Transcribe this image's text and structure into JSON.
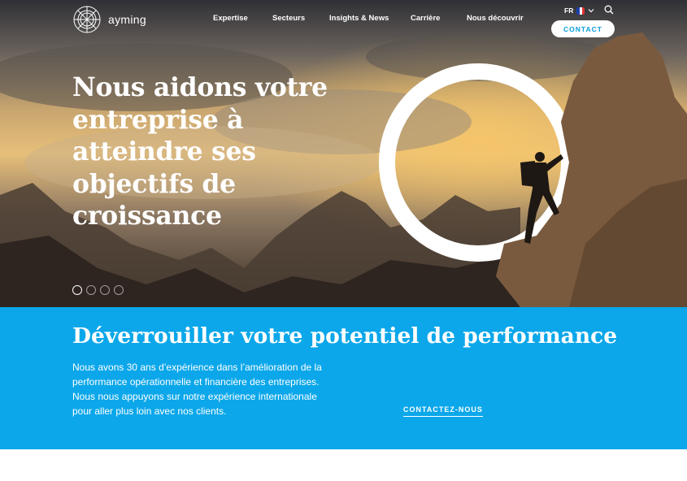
{
  "brand": {
    "name": "ayming"
  },
  "nav": {
    "items": [
      {
        "label": "Expertise"
      },
      {
        "label": "Secteurs"
      },
      {
        "label": "Insights & News"
      },
      {
        "label": "Carrière"
      },
      {
        "label": "Nous découvrir"
      }
    ],
    "language": "FR",
    "contact_label": "CONTACT"
  },
  "hero": {
    "headline": "Nous aidons votre entreprise à atteindre ses objectifs de croissance",
    "slides_total": 4,
    "active_slide": 1
  },
  "promo": {
    "title": "Déverrouiller votre potentiel de performance",
    "body": "Nous avons 30 ans d’expérience dans l’amélioration de la performance opérationnelle et financière des entreprises. Nous nous appuyons sur notre expérience internationale pour aller plus loin avec nos clients.",
    "cta_label": "CONTACTEZ-NOUS"
  },
  "colors": {
    "accent_blue": "#0ba7ea",
    "contact_text": "#0b9fdc"
  },
  "icons": [
    "ayming-logo-icon",
    "france-flag-icon",
    "chevron-down-icon",
    "search-icon"
  ]
}
